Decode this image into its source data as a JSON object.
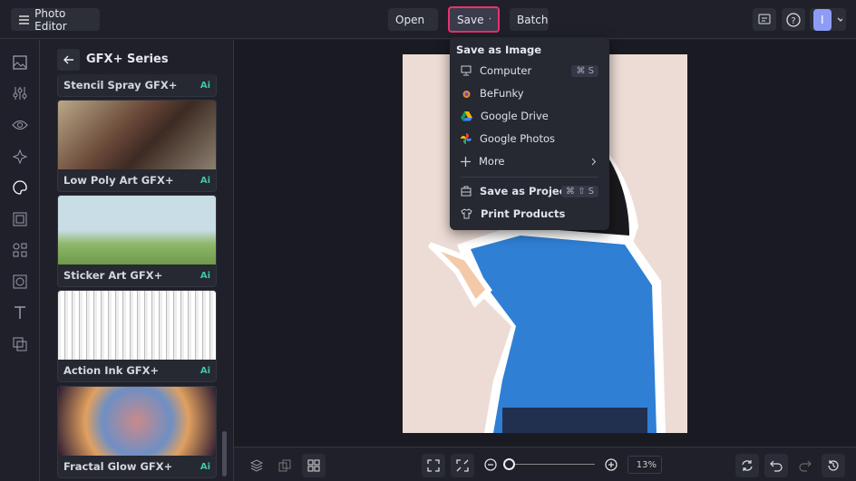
{
  "header": {
    "app_title": "Photo Editor",
    "open_label": "Open",
    "save_label": "Save",
    "batch_label": "Batch",
    "avatar_initial": "I"
  },
  "panel": {
    "title": "GFX+ Series",
    "items": [
      {
        "label": "Stencil Spray GFX+",
        "badge": "Ai"
      },
      {
        "label": "Low Poly Art GFX+",
        "badge": "Ai"
      },
      {
        "label": "Sticker Art GFX+",
        "badge": "Ai"
      },
      {
        "label": "Action Ink GFX+",
        "badge": "Ai"
      },
      {
        "label": "Fractal Glow GFX+",
        "badge": "Ai"
      }
    ]
  },
  "save_menu": {
    "heading": "Save as Image",
    "items": [
      {
        "label": "Computer",
        "shortcut": "⌘ S"
      },
      {
        "label": "BeFunky"
      },
      {
        "label": "Google Drive"
      },
      {
        "label": "Google Photos"
      },
      {
        "label": "More"
      },
      {
        "label": "Save as Project",
        "shortcut": "⌘ ⇧ S"
      },
      {
        "label": "Print Products"
      }
    ]
  },
  "bottom": {
    "zoom": "13%",
    "zoom_value_percent": 13
  },
  "colors": {
    "accent": "#e8336e",
    "avatar": "#8f9cf5",
    "ai_badge": "#3fc7a4"
  }
}
